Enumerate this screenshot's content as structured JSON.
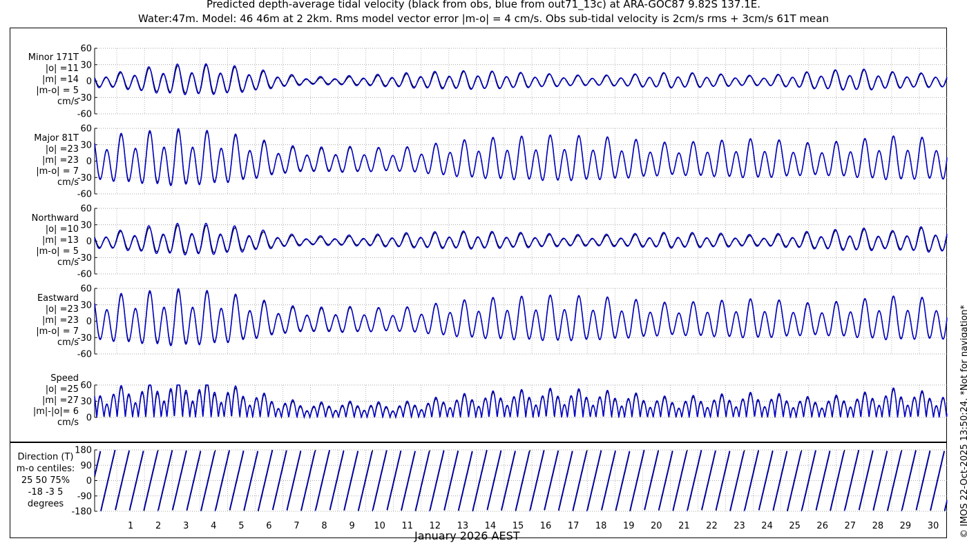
{
  "title_line1": "Predicted depth-average tidal velocity (black from obs, blue from out71_13c) at ARA-GOC87 9.82S 137.1E.",
  "title_line2": "Water:47m. Model: 46 46m at 2 2km. Rms model vector error |m-o| = 4 cm/s. Obs sub-tidal velocity is 2cm/s rms + 3cm/s 61T mean",
  "xlabel": "January 2026 AEST",
  "credit": "© IMOS 22-Oct-2025 13:50:24. *Not for navigation*",
  "panels": [
    {
      "id": "minor",
      "label": [
        "Minor 171T",
        "|o| =11",
        "|m| =14",
        "|m-o| = 5",
        "cm/s"
      ]
    },
    {
      "id": "major",
      "label": [
        "Major 81T",
        "|o| =23",
        "|m| =23",
        "|m-o| = 7",
        "cm/s"
      ]
    },
    {
      "id": "north",
      "label": [
        "Northward",
        "|o| =10",
        "|m| =13",
        "|m-o| = 5",
        "cm/s"
      ]
    },
    {
      "id": "east",
      "label": [
        "Eastward",
        "|o| =23",
        "|m| =23",
        "|m-o| = 7",
        "cm/s"
      ]
    },
    {
      "id": "speed",
      "label": [
        "Speed",
        "|o| =25",
        "|m| =27",
        "|m|-|o|= 6",
        "cm/s"
      ]
    }
  ],
  "direction_label": [
    "Direction (T)",
    "m-o centiles:",
    "25  50  75%",
    "-18  -3   5",
    "degrees"
  ],
  "colors": {
    "obs": "#000000",
    "model": "#0000cc",
    "grid": "#888888"
  },
  "chart_data": [
    {
      "type": "line",
      "panel": "minor",
      "ylim": [
        -60,
        60
      ],
      "yticks": [
        "-60",
        "-30",
        "0",
        "30",
        "60"
      ],
      "x": {
        "range": [
          0.2,
          31.0
        ],
        "ticks": [
          "1",
          "2",
          "3",
          "4",
          "5",
          "6",
          "7",
          "8",
          "9",
          "10",
          "11",
          "12",
          "13",
          "14",
          "15",
          "16",
          "17",
          "18",
          "19",
          "20",
          "21",
          "22",
          "23",
          "24",
          "25",
          "26",
          "27",
          "28",
          "29",
          "30"
        ]
      },
      "series": [
        {
          "amp": [
            11,
            12,
            20,
            24,
            26,
            24,
            18,
            10,
            5,
            6,
            8,
            10,
            13,
            14,
            16,
            14,
            12,
            10,
            8,
            9,
            11,
            13,
            12,
            10,
            8,
            10,
            14,
            17,
            18,
            14,
            12
          ],
          "phase": 0.3,
          "semi": 0.85,
          "diurnal": 0.3
        },
        {
          "amp": [
            13,
            14,
            22,
            27,
            28,
            26,
            20,
            12,
            7,
            8,
            10,
            12,
            15,
            16,
            17,
            15,
            13,
            11,
            9,
            10,
            12,
            14,
            13,
            11,
            9,
            11,
            15,
            18,
            19,
            15,
            13
          ],
          "phase": 0.45,
          "semi": 0.85,
          "diurnal": 0.3
        }
      ]
    },
    {
      "type": "line",
      "panel": "major",
      "ylim": [
        -60,
        60
      ],
      "yticks": [
        "-60",
        "-30",
        "0",
        "30",
        "60"
      ],
      "x": {
        "range": [
          0.2,
          31.0
        ]
      },
      "series": [
        {
          "amp": [
            35,
            38,
            42,
            45,
            44,
            40,
            32,
            22,
            18,
            20,
            20,
            18,
            22,
            28,
            32,
            35,
            36,
            38,
            36,
            34,
            30,
            26,
            28,
            30,
            32,
            30,
            26,
            28,
            32,
            36,
            34
          ],
          "phase": 0.0,
          "semi": 0.9,
          "diurnal": 0.35
        },
        {
          "amp": [
            36,
            40,
            44,
            48,
            46,
            42,
            34,
            24,
            20,
            22,
            21,
            19,
            23,
            29,
            33,
            36,
            37,
            39,
            37,
            35,
            31,
            27,
            29,
            31,
            33,
            31,
            27,
            29,
            33,
            37,
            35
          ],
          "phase": 0.05,
          "semi": 0.9,
          "diurnal": 0.35
        }
      ]
    },
    {
      "type": "line",
      "panel": "north",
      "ylim": [
        -60,
        60
      ],
      "yticks": [
        "-60",
        "-30",
        "0",
        "30",
        "60"
      ],
      "x": {
        "range": [
          0.2,
          31.0
        ]
      },
      "series": [
        {
          "amp": [
            12,
            14,
            20,
            24,
            25,
            22,
            16,
            10,
            6,
            7,
            8,
            10,
            12,
            13,
            14,
            12,
            11,
            9,
            8,
            9,
            10,
            12,
            11,
            10,
            8,
            10,
            13,
            16,
            18,
            14,
            20
          ],
          "phase": 0.3,
          "semi": 0.85,
          "diurnal": 0.35
        },
        {
          "amp": [
            14,
            16,
            23,
            27,
            28,
            25,
            19,
            12,
            8,
            9,
            10,
            12,
            14,
            15,
            16,
            14,
            13,
            11,
            10,
            11,
            12,
            14,
            13,
            12,
            10,
            12,
            15,
            18,
            20,
            16,
            22
          ],
          "phase": 0.45,
          "semi": 0.85,
          "diurnal": 0.35
        }
      ]
    },
    {
      "type": "line",
      "panel": "east",
      "ylim": [
        -60,
        60
      ],
      "yticks": [
        "-60",
        "-30",
        "0",
        "30",
        "60"
      ],
      "x": {
        "range": [
          0.2,
          31.0
        ]
      },
      "series": [
        {
          "amp": [
            35,
            38,
            42,
            45,
            44,
            40,
            32,
            22,
            18,
            20,
            20,
            18,
            22,
            28,
            32,
            35,
            36,
            38,
            36,
            34,
            30,
            26,
            28,
            30,
            32,
            30,
            26,
            28,
            32,
            36,
            34
          ],
          "phase": 0.0,
          "semi": 0.9,
          "diurnal": 0.35
        },
        {
          "amp": [
            36,
            40,
            44,
            48,
            46,
            42,
            34,
            24,
            20,
            22,
            21,
            19,
            23,
            29,
            33,
            36,
            37,
            39,
            37,
            35,
            31,
            27,
            29,
            31,
            33,
            31,
            27,
            29,
            33,
            37,
            35
          ],
          "phase": 0.05,
          "semi": 0.9,
          "diurnal": 0.35
        }
      ]
    },
    {
      "type": "line",
      "panel": "speed",
      "ylim": [
        0,
        60
      ],
      "yticks": [
        "0",
        "30",
        "60"
      ],
      "x": {
        "range": [
          0.2,
          31.0
        ]
      },
      "series": [
        {
          "amp": [
            38,
            40,
            44,
            48,
            46,
            42,
            34,
            24,
            18,
            20,
            20,
            18,
            22,
            28,
            32,
            35,
            36,
            38,
            36,
            34,
            30,
            26,
            28,
            30,
            32,
            30,
            26,
            28,
            32,
            38,
            34
          ],
          "phase": 0.0,
          "semi": 0.9,
          "diurnal": 0.35
        },
        {
          "amp": [
            40,
            42,
            47,
            52,
            50,
            45,
            36,
            26,
            20,
            22,
            22,
            20,
            24,
            30,
            34,
            37,
            38,
            40,
            38,
            36,
            32,
            28,
            30,
            32,
            34,
            32,
            28,
            30,
            34,
            40,
            36
          ],
          "phase": 0.05,
          "semi": 0.9,
          "diurnal": 0.35
        }
      ]
    },
    {
      "type": "line",
      "panel": "direction",
      "ylim": [
        -180,
        180
      ],
      "yticks": [
        "-180",
        "-90",
        "0",
        "90",
        "180"
      ],
      "x": {
        "range": [
          0.2,
          31.0
        ]
      },
      "series": [
        {
          "name": "obs"
        },
        {
          "name": "model"
        }
      ]
    }
  ]
}
